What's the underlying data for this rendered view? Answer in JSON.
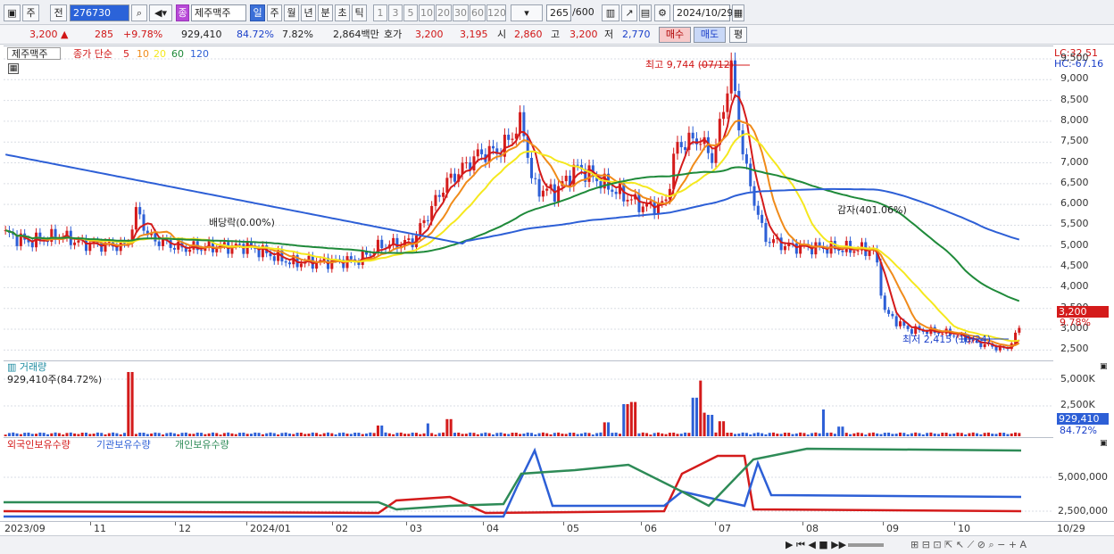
{
  "toolbar": {
    "market": "주",
    "prev": "전",
    "code": "276730",
    "stock_badge": "종",
    "stock_name": "제주맥주",
    "period_tabs": [
      "일",
      "주",
      "월",
      "년",
      "분",
      "초",
      "틱"
    ],
    "number_tabs": [
      "1",
      "3",
      "5",
      "10",
      "20",
      "30",
      "60",
      "120"
    ],
    "count": "265",
    "count_total": "/600",
    "date": "2024/10/29"
  },
  "quote": {
    "price": "3,200",
    "change": "285",
    "change_pct": "+9.78%",
    "volume": "929,410",
    "volume_pct": "84.72%",
    "turnover": "7.82%",
    "amount": "2,864백만",
    "bid_label": "호가",
    "ask": "3,200",
    "bid": "3,195",
    "open_label": "시",
    "open": "2,860",
    "high_label": "고",
    "high": "3,200",
    "low_label": "저",
    "low": "2,770",
    "buy_label": "매수",
    "sell_label": "매도",
    "eval_label": "평"
  },
  "price_panel": {
    "name": "제주맥주",
    "ma_label": "종가 단순",
    "ma_periods": [
      "5",
      "10",
      "20",
      "60",
      "120"
    ],
    "ma_colors": [
      "#d41b1b",
      "#f08b1a",
      "#f5e81e",
      "#1f8a3a",
      "#2d5fd6"
    ],
    "lc": "LC:32.51",
    "hc": "HC:-67.16",
    "high_annot": "최고 9,744 (07/12)",
    "low_annot": "최저 2,415 (10/24)",
    "div_annot": "배당락(0.00%)",
    "reduction_annot": "감자(401.06%)",
    "last_price": "3,200",
    "last_pct": "9.78%",
    "y_ticks": [
      "9,500",
      "9,000",
      "8,500",
      "8,000",
      "7,500",
      "7,000",
      "6,500",
      "6,000",
      "5,500",
      "5,000",
      "4,500",
      "4,000",
      "3,500",
      "3,000",
      "2,500"
    ]
  },
  "volume_panel": {
    "title": "거래량",
    "value": "929,410주(84.72%)",
    "y_ticks": [
      "5,000K",
      "2,500K"
    ],
    "last_value": "929,410",
    "last_pct": "84.72%"
  },
  "holdings_panel": {
    "series_labels": [
      "외국인보유수량",
      "기관보유수량",
      "개인보유수량"
    ],
    "colors": [
      "#d41b1b",
      "#2d5fd6",
      "#2e8b57"
    ],
    "y_ticks": [
      "5,000,000",
      "2,500,000"
    ]
  },
  "x_axis": {
    "labels": [
      "2023/09",
      "11",
      "12",
      "2024/01",
      "02",
      "03",
      "04",
      "05",
      "06",
      "07",
      "08",
      "09",
      "10",
      "10/29"
    ]
  }
}
